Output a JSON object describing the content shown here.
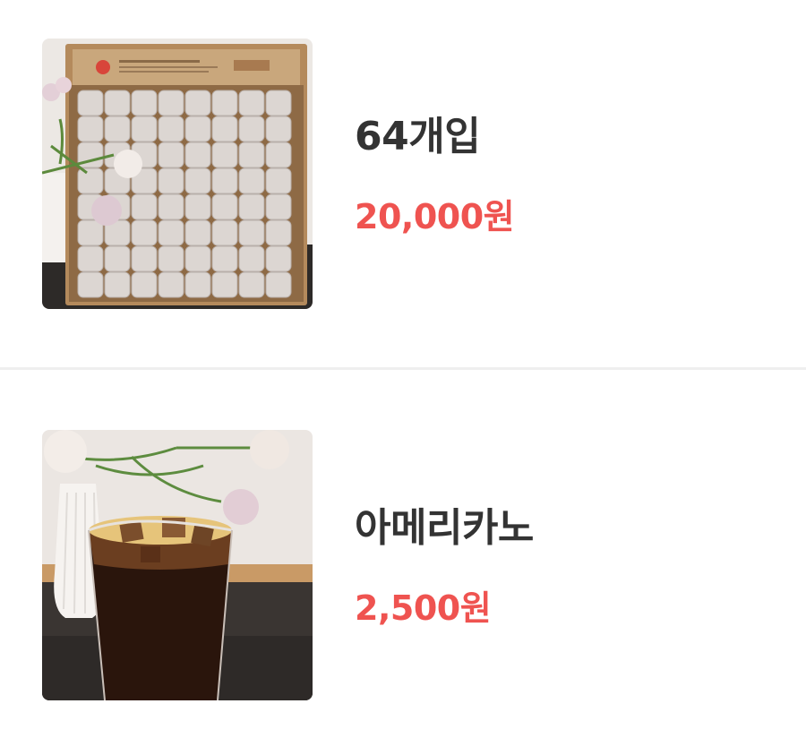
{
  "menu": {
    "items": [
      {
        "name": "64개입",
        "price": "20,000원",
        "image": "box-of-wrapped-snacks-photo"
      },
      {
        "name": "아메리카노",
        "price": "2,500원",
        "image": "iced-americano-photo"
      }
    ]
  },
  "colors": {
    "name_text": "#333333",
    "price_text": "#ef5350",
    "divider": "#efefef",
    "background": "#ffffff"
  }
}
